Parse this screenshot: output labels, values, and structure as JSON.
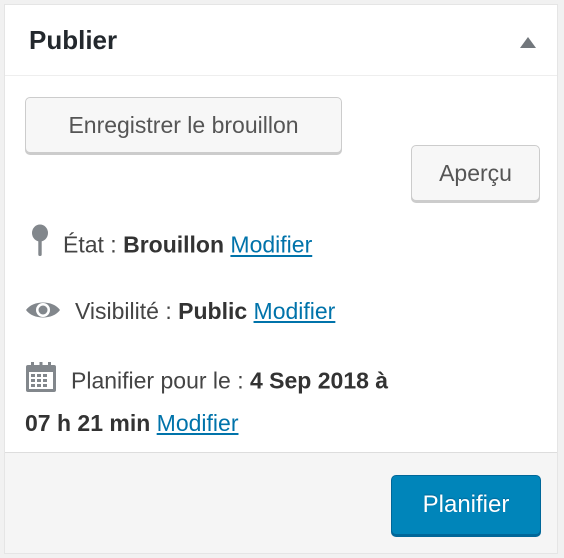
{
  "box": {
    "title": "Publier",
    "toggle_icon": "triangle-up-icon"
  },
  "actions": {
    "save_draft_label": "Enregistrer le brouillon",
    "preview_label": "Aperçu"
  },
  "status": {
    "icon": "pin-icon",
    "label": "État :",
    "value": "Brouillon",
    "edit_label": "Modifier"
  },
  "visibility": {
    "icon": "eye-icon",
    "label": "Visibilité :",
    "value": "Public",
    "edit_label": "Modifier"
  },
  "schedule": {
    "icon": "calendar-icon",
    "label": "Planifier pour le :",
    "date": "4 Sep 2018 à",
    "time": "07 h 21 min",
    "edit_label": "Modifier"
  },
  "footer": {
    "publish_label": "Planifier"
  },
  "colors": {
    "link": "#0073aa",
    "primary_button": "#0085ba",
    "primary_button_border": "#006799"
  }
}
